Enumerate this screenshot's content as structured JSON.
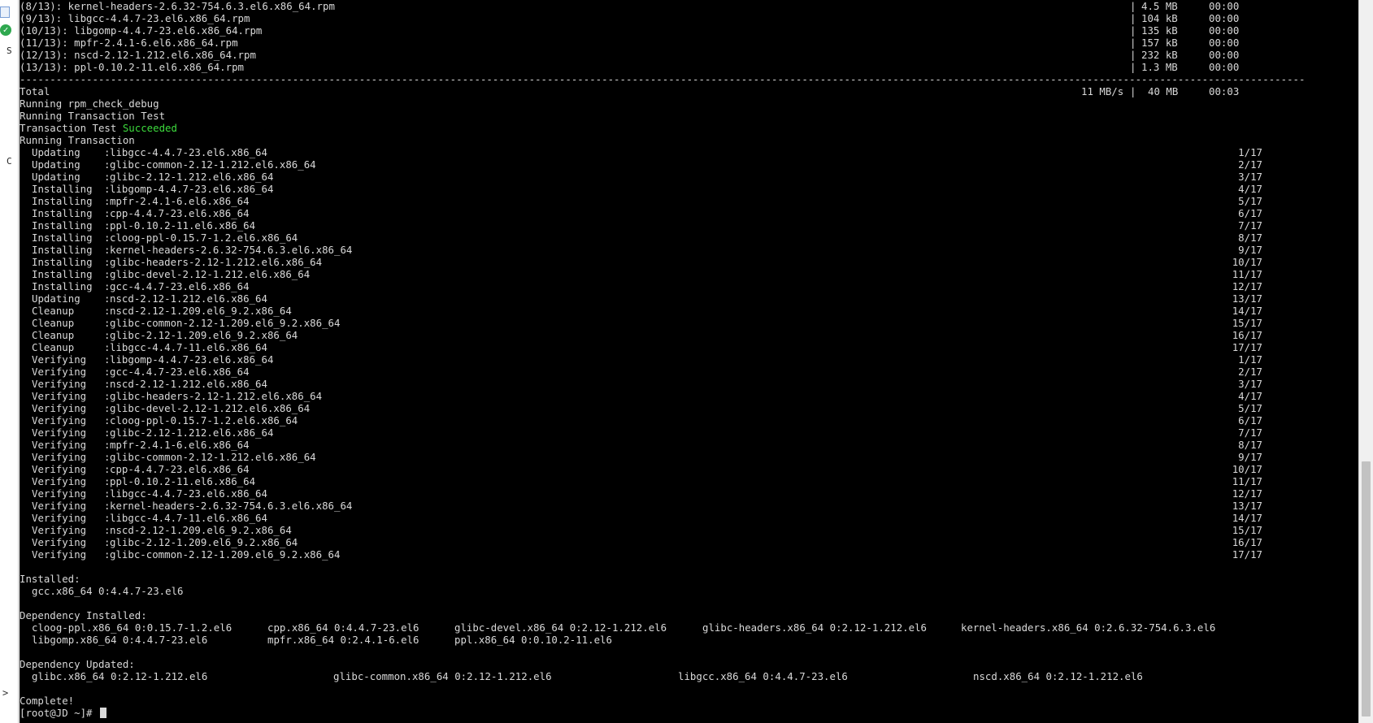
{
  "left_strip": {
    "letters": [
      "S",
      "C"
    ],
    "arrow": ">"
  },
  "terminal": {
    "download_rows": [
      {
        "file": "(8/13): kernel-headers-2.6.32-754.6.3.el6.x86_64.rpm",
        "size": "4.5 MB",
        "time": "00:00"
      },
      {
        "file": "(9/13): libgcc-4.4.7-23.el6.x86_64.rpm",
        "size": "104 kB",
        "time": "00:00"
      },
      {
        "file": "(10/13): libgomp-4.4.7-23.el6.x86_64.rpm",
        "size": "135 kB",
        "time": "00:00"
      },
      {
        "file": "(11/13): mpfr-2.4.1-6.el6.x86_64.rpm",
        "size": "157 kB",
        "time": "00:00"
      },
      {
        "file": "(12/13): nscd-2.12-1.212.el6.x86_64.rpm",
        "size": "232 kB",
        "time": "00:00"
      },
      {
        "file": "(13/13): ppl-0.10.2-11.el6.x86_64.rpm",
        "size": "1.3 MB",
        "time": "00:00"
      }
    ],
    "separator": "--------------------------------------------------------------------------------------------------------------------------------------------------------------------------------------------------------------------",
    "total": {
      "label": "Total",
      "rate": "11 MB/s",
      "size": "40 MB",
      "time": "00:03"
    },
    "pre_lines": [
      "Running rpm_check_debug",
      "Running Transaction Test"
    ],
    "test_result": {
      "prefix": "Transaction Test ",
      "status": "Succeeded"
    },
    "running_transaction": "Running Transaction",
    "transaction_steps": [
      {
        "action": "Updating",
        "package": "libgcc-4.4.7-23.el6.x86_64",
        "progress": "1/17"
      },
      {
        "action": "Updating",
        "package": "glibc-common-2.12-1.212.el6.x86_64",
        "progress": "2/17"
      },
      {
        "action": "Updating",
        "package": "glibc-2.12-1.212.el6.x86_64",
        "progress": "3/17"
      },
      {
        "action": "Installing",
        "package": "libgomp-4.4.7-23.el6.x86_64",
        "progress": "4/17"
      },
      {
        "action": "Installing",
        "package": "mpfr-2.4.1-6.el6.x86_64",
        "progress": "5/17"
      },
      {
        "action": "Installing",
        "package": "cpp-4.4.7-23.el6.x86_64",
        "progress": "6/17"
      },
      {
        "action": "Installing",
        "package": "ppl-0.10.2-11.el6.x86_64",
        "progress": "7/17"
      },
      {
        "action": "Installing",
        "package": "cloog-ppl-0.15.7-1.2.el6.x86_64",
        "progress": "8/17"
      },
      {
        "action": "Installing",
        "package": "kernel-headers-2.6.32-754.6.3.el6.x86_64",
        "progress": "9/17"
      },
      {
        "action": "Installing",
        "package": "glibc-headers-2.12-1.212.el6.x86_64",
        "progress": "10/17"
      },
      {
        "action": "Installing",
        "package": "glibc-devel-2.12-1.212.el6.x86_64",
        "progress": "11/17"
      },
      {
        "action": "Installing",
        "package": "gcc-4.4.7-23.el6.x86_64",
        "progress": "12/17"
      },
      {
        "action": "Updating",
        "package": "nscd-2.12-1.212.el6.x86_64",
        "progress": "13/17"
      },
      {
        "action": "Cleanup",
        "package": "nscd-2.12-1.209.el6_9.2.x86_64",
        "progress": "14/17"
      },
      {
        "action": "Cleanup",
        "package": "glibc-common-2.12-1.209.el6_9.2.x86_64",
        "progress": "15/17"
      },
      {
        "action": "Cleanup",
        "package": "glibc-2.12-1.209.el6_9.2.x86_64",
        "progress": "16/17"
      },
      {
        "action": "Cleanup",
        "package": "libgcc-4.4.7-11.el6.x86_64",
        "progress": "17/17"
      },
      {
        "action": "Verifying",
        "package": "libgomp-4.4.7-23.el6.x86_64",
        "progress": "1/17"
      },
      {
        "action": "Verifying",
        "package": "gcc-4.4.7-23.el6.x86_64",
        "progress": "2/17"
      },
      {
        "action": "Verifying",
        "package": "nscd-2.12-1.212.el6.x86_64",
        "progress": "3/17"
      },
      {
        "action": "Verifying",
        "package": "glibc-headers-2.12-1.212.el6.x86_64",
        "progress": "4/17"
      },
      {
        "action": "Verifying",
        "package": "glibc-devel-2.12-1.212.el6.x86_64",
        "progress": "5/17"
      },
      {
        "action": "Verifying",
        "package": "cloog-ppl-0.15.7-1.2.el6.x86_64",
        "progress": "6/17"
      },
      {
        "action": "Verifying",
        "package": "glibc-2.12-1.212.el6.x86_64",
        "progress": "7/17"
      },
      {
        "action": "Verifying",
        "package": "mpfr-2.4.1-6.el6.x86_64",
        "progress": "8/17"
      },
      {
        "action": "Verifying",
        "package": "glibc-common-2.12-1.212.el6.x86_64",
        "progress": "9/17"
      },
      {
        "action": "Verifying",
        "package": "cpp-4.4.7-23.el6.x86_64",
        "progress": "10/17"
      },
      {
        "action": "Verifying",
        "package": "ppl-0.10.2-11.el6.x86_64",
        "progress": "11/17"
      },
      {
        "action": "Verifying",
        "package": "libgcc-4.4.7-23.el6.x86_64",
        "progress": "12/17"
      },
      {
        "action": "Verifying",
        "package": "kernel-headers-2.6.32-754.6.3.el6.x86_64",
        "progress": "13/17"
      },
      {
        "action": "Verifying",
        "package": "libgcc-4.4.7-11.el6.x86_64",
        "progress": "14/17"
      },
      {
        "action": "Verifying",
        "package": "nscd-2.12-1.209.el6_9.2.x86_64",
        "progress": "15/17"
      },
      {
        "action": "Verifying",
        "package": "glibc-2.12-1.209.el6_9.2.x86_64",
        "progress": "16/17"
      },
      {
        "action": "Verifying",
        "package": "glibc-common-2.12-1.209.el6_9.2.x86_64",
        "progress": "17/17"
      }
    ],
    "installed_label": "Installed:",
    "installed": [
      "gcc.x86_64 0:4.4.7-23.el6"
    ],
    "dep_installed_label": "Dependency Installed:",
    "dep_installed_rows": [
      [
        "cloog-ppl.x86_64 0:0.15.7-1.2.el6",
        "cpp.x86_64 0:4.4.7-23.el6",
        "glibc-devel.x86_64 0:2.12-1.212.el6",
        "glibc-headers.x86_64 0:2.12-1.212.el6",
        "kernel-headers.x86_64 0:2.6.32-754.6.3.el6"
      ],
      [
        "libgomp.x86_64 0:4.4.7-23.el6",
        "mpfr.x86_64 0:2.4.1-6.el6",
        "ppl.x86_64 0:0.10.2-11.el6"
      ]
    ],
    "dep_updated_label": "Dependency Updated:",
    "dep_updated": [
      "glibc.x86_64 0:2.12-1.212.el6",
      "glibc-common.x86_64 0:2.12-1.212.el6",
      "libgcc.x86_64 0:4.4.7-23.el6",
      "nscd.x86_64 0:2.12-1.212.el6"
    ],
    "complete": "Complete!",
    "prompt": "[root@JD ~]# "
  }
}
